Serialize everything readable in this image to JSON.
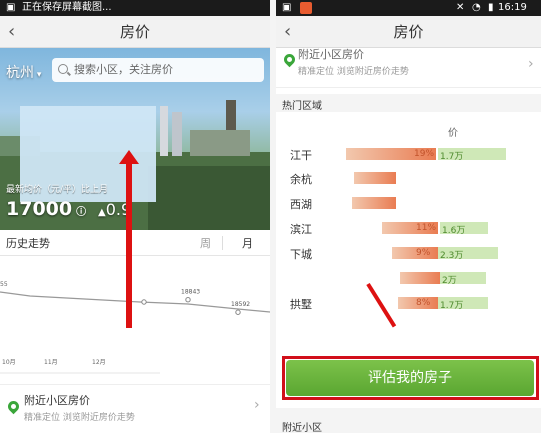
{
  "left": {
    "status_text": "正在保存屏幕截图...",
    "nav_title": "房价",
    "back": "‹",
    "city": "杭州",
    "search_placeholder": "搜索小区，关注房价",
    "price_label": "最新均价（元/平）比上月",
    "price_value": "17000",
    "price_change": "0.9",
    "trend_title": "历史走势",
    "tabs": [
      "周",
      "月"
    ],
    "chart_data": {
      "type": "line",
      "categories": [
        "10月",
        "11月",
        "12月"
      ],
      "series": [
        {
          "values": [
            18843,
            18592
          ]
        }
      ],
      "point_labels": [
        "18843",
        "18592"
      ],
      "y_label_partial": "55"
    },
    "nearby_title": "附近小区房价",
    "nearby_sub": "精准定位 浏览附近房价走势"
  },
  "right": {
    "status_time": "16:19",
    "nav_title": "房价",
    "nearby_title": "附近小区房价",
    "nearby_sub": "精准定位 浏览附近房价走势",
    "hot_section": "热门区域",
    "col_head": "价",
    "districts": [
      {
        "name": "江干",
        "pct": "19%",
        "val": "1.7万"
      },
      {
        "name": "余杭",
        "pct": "",
        "val": ""
      },
      {
        "name": "西湖",
        "pct": "",
        "val": ""
      },
      {
        "name": "滨江",
        "pct": "11%",
        "val": "1.6万"
      },
      {
        "name": "下城",
        "pct": "9%",
        "val": "2.3万"
      },
      {
        "name": "",
        "pct": "",
        "val": "2万"
      },
      {
        "name": "拱墅",
        "pct": "8%",
        "val": "1.7万"
      }
    ],
    "cta_label": "评估我的房子",
    "bottom_section": "附近小区"
  },
  "colors": {
    "accent_green": "#5aa631",
    "highlight_red": "#d10f1a",
    "bar_orange": "#e97c52",
    "bar_green": "#cfe8b7"
  }
}
